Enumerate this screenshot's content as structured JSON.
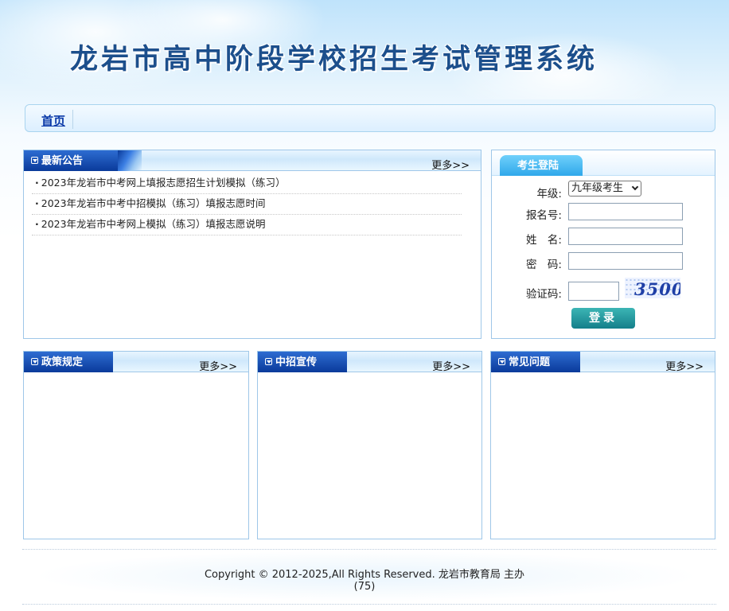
{
  "header": {
    "title": "龙岩市高中阶段学校招生考试管理系统"
  },
  "nav": {
    "home": "首页"
  },
  "notices": {
    "title": "最新公告",
    "more": "更多>>",
    "items": [
      "2023年龙岩市中考网上填报志愿招生计划模拟（练习）",
      "2023年龙岩市中考中招模拟（练习）填报志愿时间",
      "2023年龙岩市中考网上模拟（练习）填报志愿说明"
    ]
  },
  "login": {
    "title": "考生登陆",
    "grade_label": "年级:",
    "grade_value": "九年级考生",
    "reg_label": "报名号:",
    "name_label": "姓　名:",
    "password_label": "密　码:",
    "captcha_label": "验证码:",
    "captcha_text": "3500",
    "submit": "登录"
  },
  "policy": {
    "title": "政策规定",
    "more": "更多>>"
  },
  "publicity": {
    "title": "中招宣传",
    "more": "更多>>"
  },
  "faq": {
    "title": "常见问题",
    "more": "更多>>"
  },
  "footer": {
    "copyright": "Copyright © 2012-2025,All Rights Reserved. 龙岩市教育局 主办",
    "counter": "(75)"
  }
}
